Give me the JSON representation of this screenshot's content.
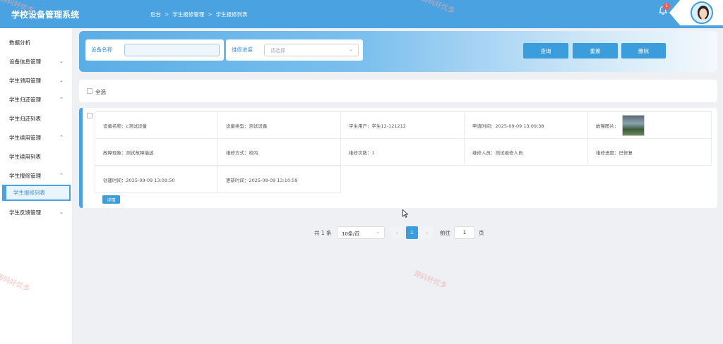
{
  "app_title": "学校设备管理系统",
  "breadcrumb": [
    "后台",
    "学生报修管理",
    "学生报修列表"
  ],
  "breadcrumb_sep": ">",
  "notification_count": "1",
  "sidebar": {
    "items": [
      {
        "label": "数据分析",
        "chev": ""
      },
      {
        "label": "设备信息管理",
        "chev": "⌄"
      },
      {
        "label": "学生领用管理",
        "chev": "⌄"
      },
      {
        "label": "学生归还管理",
        "chev": "⌃"
      },
      {
        "label": "学生归还列表",
        "chev": ""
      },
      {
        "label": "学生续用管理",
        "chev": "⌃"
      },
      {
        "label": "学生续用列表",
        "chev": ""
      },
      {
        "label": "学生报修管理",
        "chev": "⌃"
      },
      {
        "label": "学生反馈管理",
        "chev": "⌄"
      }
    ],
    "active": "学生报修列表"
  },
  "search": {
    "name_label": "设备名称",
    "name_value": "",
    "progress_label": "维修进度",
    "progress_placeholder": "请选择",
    "query_btn": "查询",
    "reset_btn": "重置",
    "delete_btn": "删除"
  },
  "select_all_label": "全选",
  "record": {
    "cells": [
      "设备名称：c测试设备",
      "设备类型：测试设备",
      "学生用户：学生12-121212",
      "申请时间：2025-09-09 13:09:38",
      "故障图片：",
      "故障现象：测试故障描述",
      "维修方式：校内",
      "维修次数：1",
      "维修人员：测试维修人员",
      "维修进度：已修复",
      "创建时间：2025-09-09 13:09:50",
      "更新时间：2025-09-09 13:10:59"
    ],
    "detail_btn": "详情"
  },
  "pagination": {
    "total": "共 1 条",
    "page_size": "10条/页",
    "prev": "‹",
    "current": "1",
    "next": "›",
    "goto_label": "前往",
    "goto_value": "1",
    "page_unit": "页"
  },
  "watermark": "源码好优多",
  "colors": {
    "primary": "#4aa3e0",
    "button": "#3b9ddb"
  }
}
